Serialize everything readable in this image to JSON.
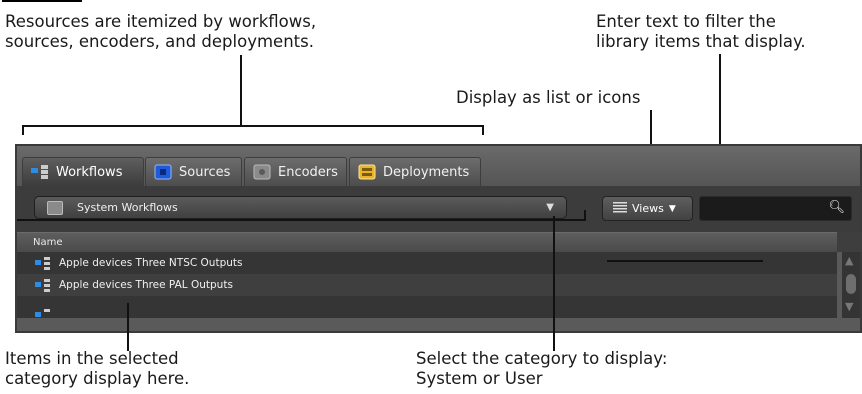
{
  "callouts": {
    "resources": [
      "Resources are itemized by workflows,",
      "sources, encoders, and deployments."
    ],
    "filter": [
      "Enter text to filter the",
      "library items that display."
    ],
    "display_as": "Display as list or icons",
    "items": [
      "Items in the selected",
      "category display here."
    ],
    "select_category": [
      "Select the category to display:",
      "System or User"
    ]
  },
  "tabs": [
    {
      "label": "Workflows",
      "icon": "workflow-icon"
    },
    {
      "label": "Sources",
      "icon": "sources-icon"
    },
    {
      "label": "Encoders",
      "icon": "encoders-icon"
    },
    {
      "label": "Deployments",
      "icon": "deployments-icon"
    }
  ],
  "toolbar": {
    "category_dropdown": "System Workflows",
    "views_label": "Views",
    "search_value": ""
  },
  "list": {
    "header_name": "Name",
    "rows": [
      "Apple devices Three NTSC Outputs",
      "Apple devices Three PAL Outputs",
      ""
    ]
  },
  "colors": {
    "panel_bg": "#5a5a5a",
    "row_odd": "#353535",
    "row_even": "#3f3f3f",
    "workflow_blue": "#2e8de0",
    "sources_blue": "#1f5bd8",
    "deployments_yellow": "#e8b42a"
  }
}
